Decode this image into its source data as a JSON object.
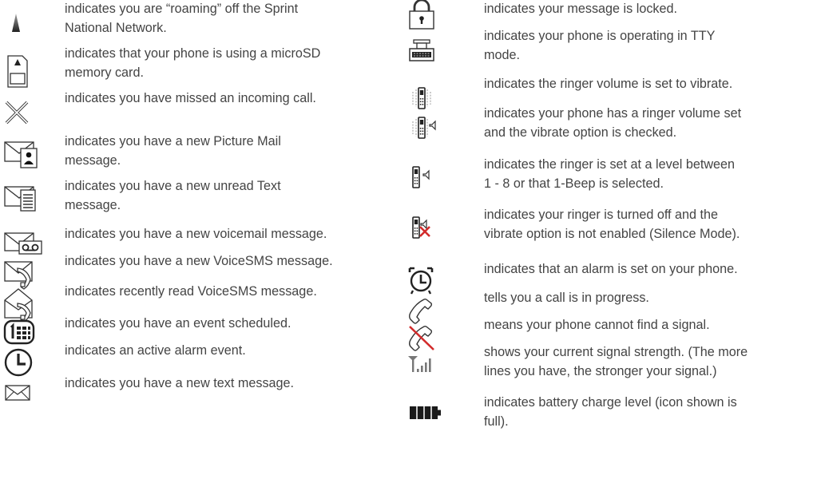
{
  "left_column": {
    "entries": [
      {
        "icon": "roaming-triangle-icon",
        "text": "indicates you are “roaming” off the Sprint\nNational Network."
      },
      {
        "icon": "microsd-card-icon",
        "text": "indicates that your phone is using a microSD\nmemory card."
      },
      {
        "icon": "missed-call-x-icon",
        "text": "indicates you have missed an incoming call."
      },
      {
        "icon": "picture-mail-icon",
        "text": "indicates you have a new Picture Mail\nmessage."
      },
      {
        "icon": "text-message-icon",
        "text": "indicates you have a new unread Text\nmessage."
      },
      {
        "icon": "voicemail-icon",
        "text": "indicates you have a new voicemail message."
      },
      {
        "icon": "voicesms-new-icon",
        "text": "indicates you have a new VoiceSMS message."
      },
      {
        "icon": "voicesms-read-icon",
        "text": "indicates recently read VoiceSMS message."
      },
      {
        "icon": "calendar-event-icon",
        "text": "indicates you have an event scheduled."
      },
      {
        "icon": "alarm-clock-icon",
        "text": "indicates an active alarm event."
      },
      {
        "icon": "envelope-icon",
        "text": "indicates you have a new text message."
      }
    ]
  },
  "right_column": {
    "entries": [
      {
        "icon": "lock-icon",
        "text": "indicates your message is locked."
      },
      {
        "icon": "tty-icon",
        "text": "indicates your phone is operating in TTY\nmode."
      },
      {
        "icon": "vibrate-icon",
        "text": "indicates the ringer volume is set to vibrate."
      },
      {
        "icon": "vibrate-ringer-icon",
        "text": "indicates your phone has a ringer volume set\nand the vibrate option is checked."
      },
      {
        "icon": "ringer-icon",
        "text": "indicates the ringer is set at a level between\n1 - 8 or that 1-Beep is selected."
      },
      {
        "icon": "ringer-off-icon",
        "text": "indicates your ringer is turned off and the\nvibrate option is not enabled (Silence Mode)."
      },
      {
        "icon": "alarm-set-icon",
        "text": "indicates that an alarm is set on your phone."
      },
      {
        "icon": "call-in-progress-icon",
        "text": "tells you a call is in progress."
      },
      {
        "icon": "no-signal-icon",
        "text": "means your phone cannot find a signal."
      },
      {
        "icon": "signal-strength-icon",
        "text": "shows your current signal strength. (The more\nlines you have, the stronger your signal.)"
      },
      {
        "icon": "battery-icon",
        "text": "indicates battery charge level (icon shown is\nfull)."
      }
    ]
  },
  "colors": {
    "text": "#444444",
    "icon_stroke": "#333333",
    "icon_dark": "#111111",
    "alert_red": "#d22b2b"
  }
}
